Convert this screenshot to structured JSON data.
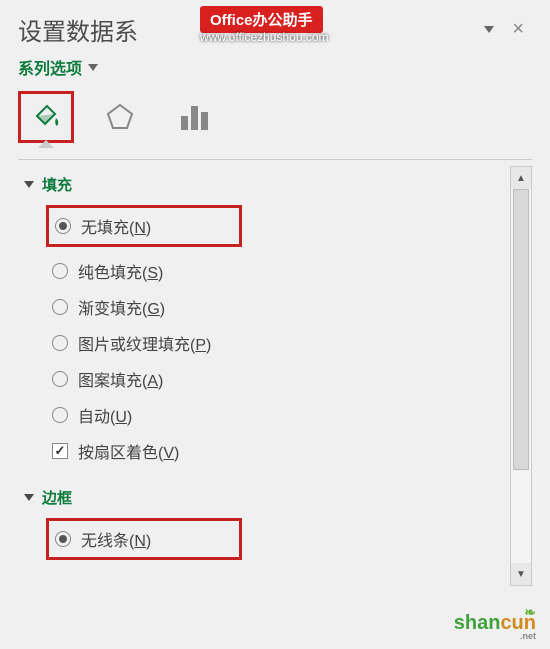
{
  "pane": {
    "title": "设置数据系",
    "close": "×",
    "dropdown_label": "系列选项"
  },
  "tabs": {
    "fill": "paint-bucket",
    "effects": "pentagon",
    "size": "bar-chart"
  },
  "sections": {
    "fill": {
      "title": "填充",
      "options": [
        {
          "label": "无填充",
          "hotkey": "N",
          "checked": true,
          "highlighted": true
        },
        {
          "label": "纯色填充",
          "hotkey": "S",
          "checked": false
        },
        {
          "label": "渐变填充",
          "hotkey": "G",
          "checked": false
        },
        {
          "label": "图片或纹理填充",
          "hotkey": "P",
          "checked": false
        },
        {
          "label": "图案填充",
          "hotkey": "A",
          "checked": false
        },
        {
          "label": "自动",
          "hotkey": "U",
          "checked": false
        }
      ],
      "checkbox": {
        "label": "按扇区着色",
        "hotkey": "V",
        "checked": true
      }
    },
    "border": {
      "title": "边框",
      "options": [
        {
          "label": "无线条",
          "hotkey": "N",
          "checked": true,
          "highlighted": true
        }
      ]
    }
  },
  "watermark": {
    "red_label": "Office办公助手",
    "url": "www.officezhushou.com",
    "bottom_shan": "shan",
    "bottom_cun": "cun",
    "bottom_net": ".net"
  }
}
